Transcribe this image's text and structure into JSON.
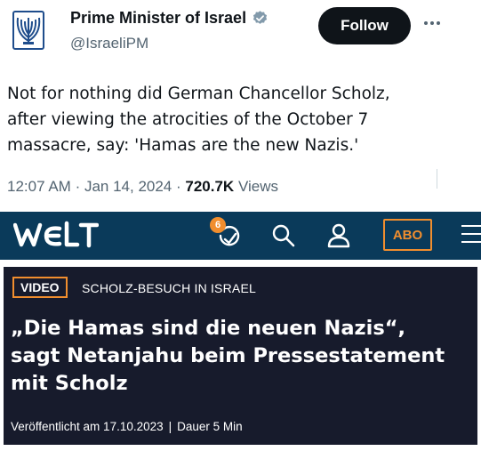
{
  "tweet": {
    "display_name": "Prime Minister of Israel",
    "handle": "@IsraeliPM",
    "follow_label": "Follow",
    "text_lines": [
      "Not for nothing did German Chancellor Scholz,",
      "after viewing the atrocities of the October 7",
      "massacre, say: 'Hamas are the new Nazis.'"
    ],
    "time": "12:07 AM",
    "date": "Jan 14, 2024",
    "views_count": "720.7K",
    "views_label": "Views",
    "verified_color": "#829aab",
    "avatar_icon": "menorah-emblem-icon"
  },
  "welt": {
    "logo": "WELT",
    "notification_count": "6",
    "abo_label": "ABO",
    "bar_color": "#0a3a5a",
    "accent_color": "#f18e2e"
  },
  "article": {
    "tag": "VIDEO",
    "kicker": "SCHOLZ-BESUCH IN ISRAEL",
    "headline_lines": [
      "„Die Hamas sind die neuen Nazis“,",
      "sagt Netanjahu beim Pressestatement",
      "mit Scholz"
    ],
    "published": "Veröffentlicht am 17.10.2023",
    "duration": "Dauer 5 Min",
    "separator": "|",
    "card_color": "#171b2c"
  }
}
